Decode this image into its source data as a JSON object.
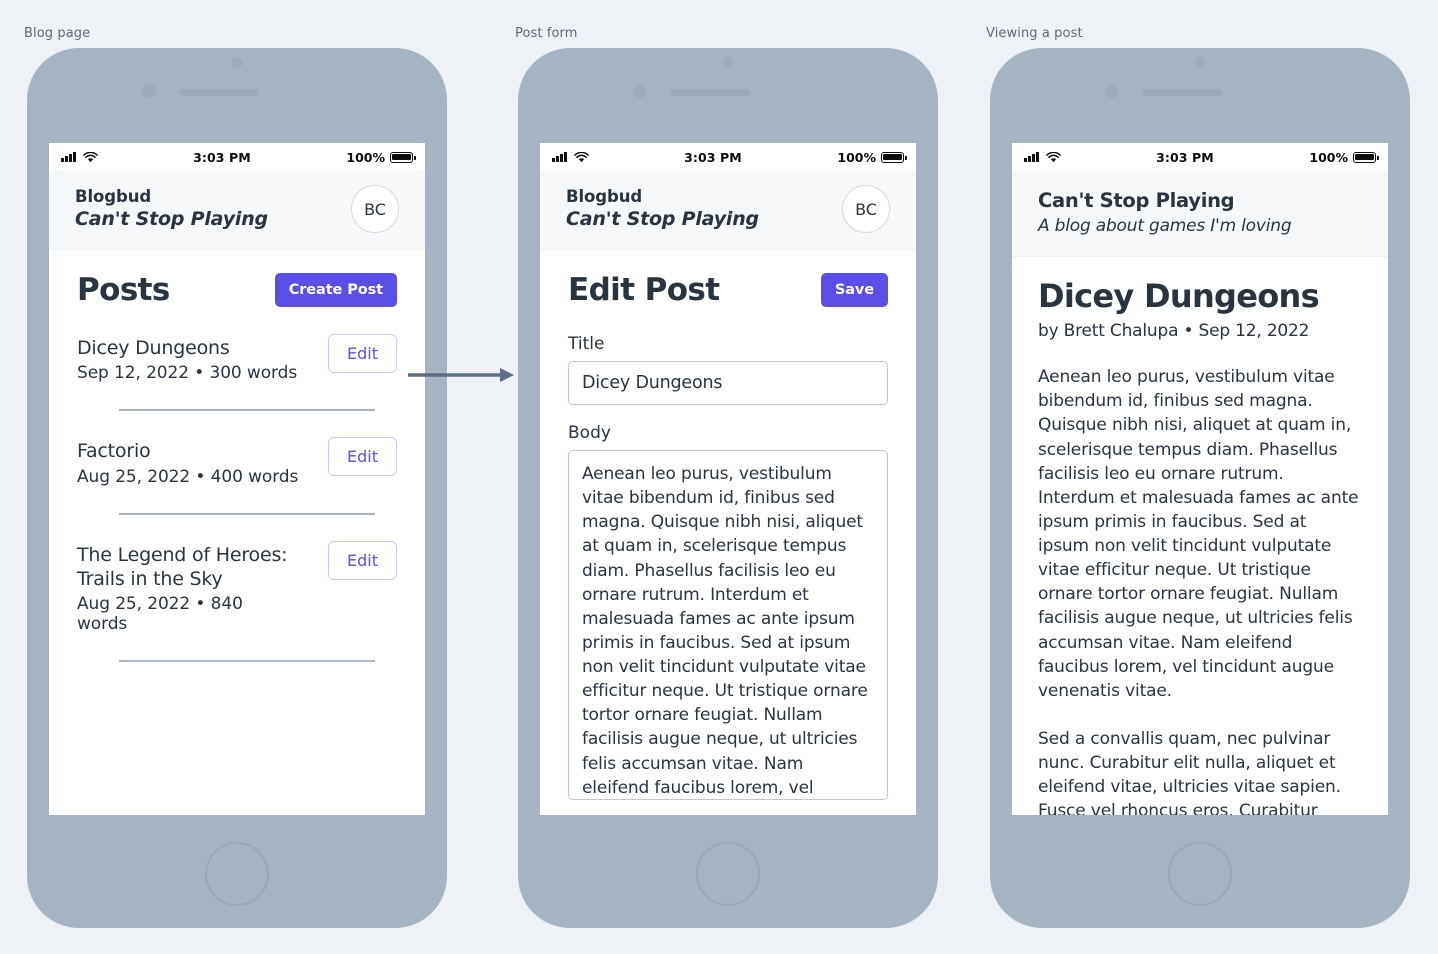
{
  "captions": {
    "phone1": "Blog page",
    "phone2": "Post form",
    "phone3": "Viewing a post"
  },
  "colors": {
    "accent": "#5b4ee6",
    "accent_outline": "#cfc8f5",
    "phone_body": "#a6b3c2",
    "page_bg": "#eef2f6",
    "text": "#2a3440",
    "appbar_bg": "#f6f8fa",
    "divider": "#a9b6c4",
    "input_border": "#bcc7d3"
  },
  "status_bar": {
    "time": "3:03 PM",
    "battery_percent": "100%",
    "signal_icon": "cellular-bars-icon",
    "wifi_icon": "wifi-icon",
    "battery_icon": "battery-full-icon"
  },
  "blog": {
    "brand": "Blogbud",
    "tagline": "Can't Stop Playing",
    "avatar_initials": "BC"
  },
  "blog_page": {
    "title": "Posts",
    "create_button": "Create Post",
    "edit_button": "Edit",
    "posts": [
      {
        "title": "Dicey Dungeons",
        "meta": "Sep 12, 2022  • 300 words",
        "edit_label": "Edit"
      },
      {
        "title": "Factorio",
        "meta": "Aug 25, 2022   • 400 words",
        "edit_label": "Edit"
      },
      {
        "title": "The Legend of Heroes: Trails in the Sky",
        "meta": "Aug 25, 2022   • 840 words",
        "edit_label": "Edit"
      }
    ]
  },
  "post_form": {
    "title": "Edit Post",
    "save_button": "Save",
    "title_label": "Title",
    "title_value": "Dicey Dungeons",
    "body_label": "Body",
    "body_value": "Aenean leo purus, vestibulum vitae bibendum id, finibus sed magna. Quisque nibh nisi, aliquet at quam in, scelerisque tempus diam. Phasellus facilisis leo eu ornare rutrum. Interdum et malesuada fames ac ante ipsum primis in faucibus. Sed at ipsum non velit tincidunt vulputate vitae efficitur neque. Ut tristique ornare tortor ornare feugiat. Nullam facilisis augue neque, ut ultricies felis accumsan vitae. Nam eleifend faucibus lorem, vel tincidunt augue venenatis vitae. Mauris sit amet"
  },
  "reader": {
    "blog_title": "Can't Stop Playing",
    "blog_subtitle": "A blog about games I'm loving",
    "post_title": "Dicey Dungeons",
    "byline": "by Brett Chalupa • Sep 12, 2022",
    "paragraph_1": "Aenean leo purus, vestibulum vitae bibendum id, finibus sed magna. Quisque nibh nisi, aliquet at quam in, scelerisque tempus diam. Phasellus facilisis leo eu ornare rutrum. Interdum et malesuada fames ac ante ipsum primis in faucibus. Sed at ipsum non velit tincidunt vulputate vitae efficitur neque. Ut tristique ornare tortor ornare feugiat. Nullam facilisis augue neque, ut ultricies felis accumsan vitae. Nam eleifend faucibus lorem, vel tincidunt augue venenatis vitae.",
    "paragraph_2": "Sed a convallis quam, nec pulvinar nunc. Curabitur elit nulla, aliquet et eleifend vitae, ultricies vitae sapien. Fusce vel rhoncus eros. Curabitur pellentesque"
  }
}
